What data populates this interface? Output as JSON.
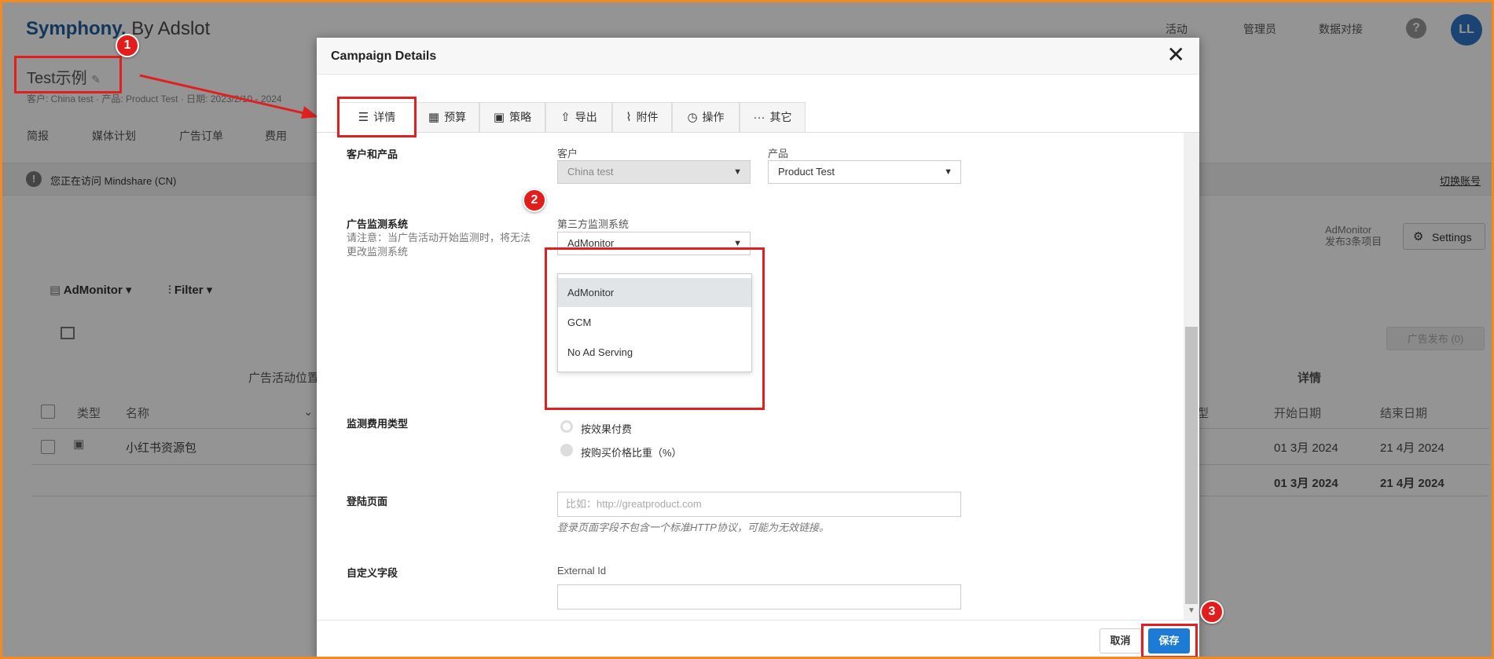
{
  "brand": {
    "name_bold": "Symphony.",
    "name_rest": " By Adslot"
  },
  "topnav": {
    "activity": "活动",
    "admin": "管理员",
    "data_connect": "数据对接"
  },
  "help_label": "?",
  "avatar_initials": "LL",
  "campaign": {
    "title": "Test示例",
    "meta": "客户: China test · 产品: Product Test · 日期: 2023/2/10 - 2024"
  },
  "subnav": {
    "overview": "简报",
    "media_plan": "媒体计划",
    "ad_orders": "广告订单",
    "costs": "费用"
  },
  "notice": {
    "icon": "!",
    "text": "您正在访问 Mindshare (CN)",
    "switch": "切换账号"
  },
  "side_info": {
    "line1": "AdMonitor",
    "line2": "发布3条项目"
  },
  "settings": {
    "label": "Settings",
    "icon": "gear-icon"
  },
  "toolbar": {
    "admonitor": "AdMonitor ▾",
    "filter": "Filter ▾",
    "publish": "广告发布 (0)"
  },
  "table": {
    "group_left": "广告活动位置",
    "group_right": "详情",
    "headers": {
      "type": "类型",
      "name": "名称",
      "start": "开始日期",
      "end": "结束日期",
      "partial": "型"
    },
    "row": {
      "name": "小红书资源包",
      "start": "01 3月 2024",
      "end": "21 4月 2024"
    },
    "total": {
      "start": "01 3月 2024",
      "end": "21 4月 2024"
    }
  },
  "modal": {
    "title": "Campaign Details",
    "tabs": [
      {
        "label": "详情",
        "icon": "list-icon",
        "glyph": "☰"
      },
      {
        "label": "预算",
        "icon": "calculator-icon",
        "glyph": "▦"
      },
      {
        "label": "策略",
        "icon": "strategy-icon",
        "glyph": "▣"
      },
      {
        "label": "导出",
        "icon": "export-icon",
        "glyph": "⇧"
      },
      {
        "label": "附件",
        "icon": "paperclip-icon",
        "glyph": "⌇"
      },
      {
        "label": "操作",
        "icon": "clock-icon",
        "glyph": "◷"
      },
      {
        "label": "其它",
        "icon": "more-icon",
        "glyph": "···"
      }
    ],
    "client_product": {
      "section": "客户和产品",
      "client_label": "客户",
      "client_value": "China test",
      "product_label": "产品",
      "product_value": "Product Test"
    },
    "ad_monitoring": {
      "section": "广告监测系统",
      "note": "请注意：当广告活动开始监测时，将无法更改监测系统",
      "field_label": "第三方监测系统",
      "value": "AdMonitor",
      "options": [
        "AdMonitor",
        "GCM",
        "No Ad Serving"
      ]
    },
    "fee_type": {
      "section": "监测费用类型",
      "options": [
        "按效果付费",
        "按购买价格比重（%）"
      ]
    },
    "landing": {
      "section": "登陆页面",
      "placeholder": "比如：http://greatproduct.com",
      "hint": "登录页面字段不包含一个标准HTTP协议，可能为无效链接。"
    },
    "custom": {
      "section": "自定义字段",
      "field_label": "External Id",
      "value": ""
    },
    "cancel": "取消",
    "save": "保存"
  },
  "markers": [
    "1",
    "2",
    "3"
  ],
  "colors": {
    "highlight": "#e02020",
    "primary": "#1d7bd3",
    "marker": "#e31c1c",
    "frame": "#f08a24"
  }
}
